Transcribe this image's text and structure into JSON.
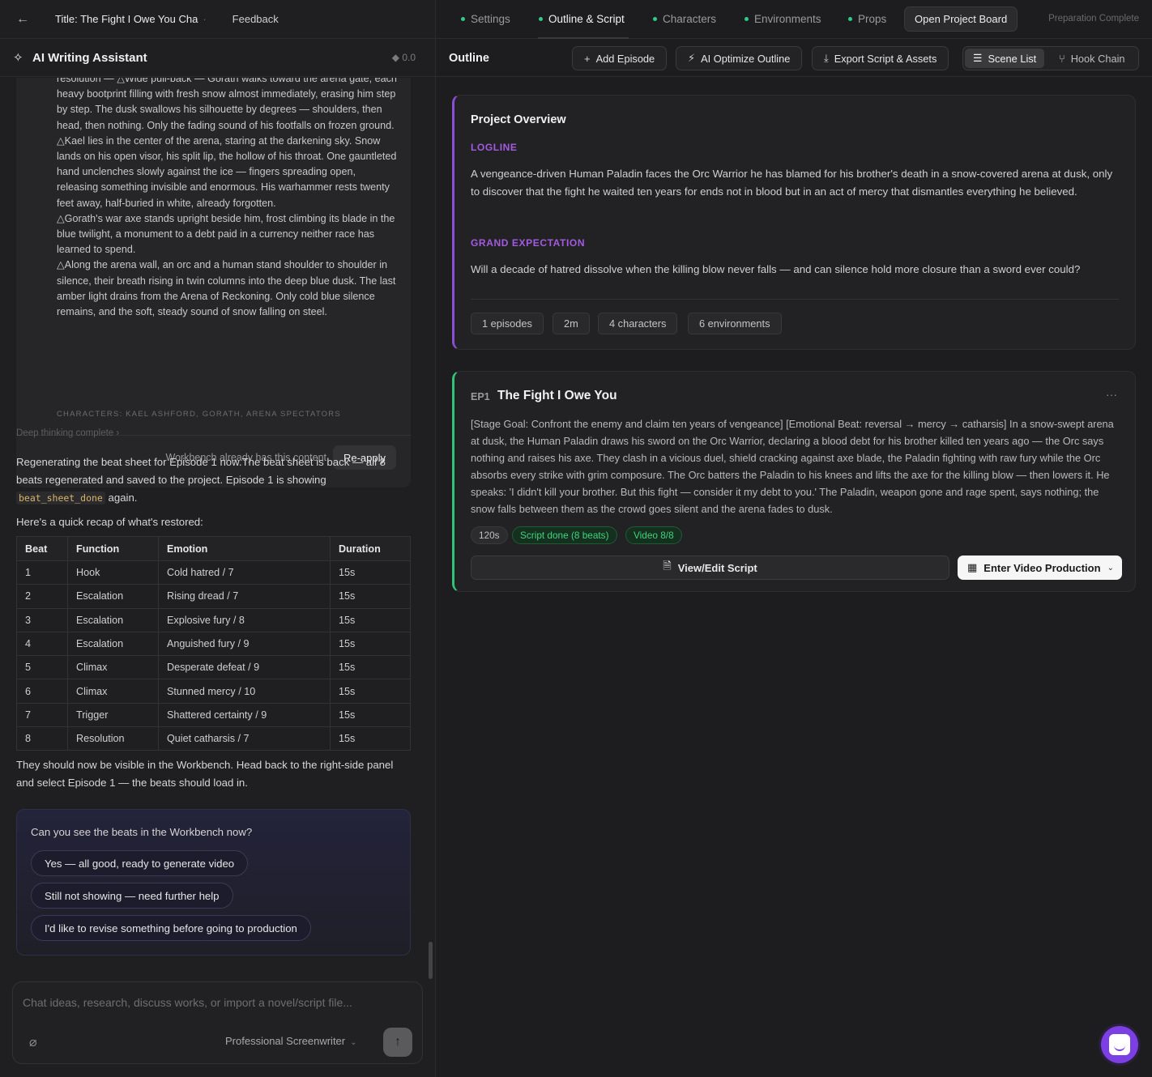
{
  "topbar": {
    "back_icon": "arrow-left-icon",
    "project_title": "Title: The Fight I Owe You Cha",
    "feedback": "Feedback"
  },
  "assistant": {
    "title": "AI Writing Assistant",
    "credits": "◆ 0.0"
  },
  "script_block": {
    "lines": [
      "resolution — △Wide pull-back — Gorath walks toward the arena gate, each heavy bootprint filling with fresh snow almost immediately, erasing him step by step. The dusk swallows his silhouette by degrees — shoulders, then head, then nothing. Only the fading sound of his footfalls on frozen ground.",
      "△Kael lies in the center of the arena, staring at the darkening sky. Snow lands on his open visor, his split lip, the hollow of his throat. One gauntleted hand unclenches slowly against the ice — fingers spreading open, releasing something invisible and enormous. His warhammer rests twenty feet away, half-buried in white, already forgotten.",
      "△Gorath's war axe stands upright beside him, frost climbing its blade in the blue twilight, a monument to a debt paid in a currency neither race has learned to spend.",
      "△Along the arena wall, an orc and a human stand shoulder to shoulder in silence, their breath rising in twin columns into the deep blue dusk. The last amber light drains from the Arena of Reckoning. Only cold blue silence remains, and the soft, steady sound of snow falling on steel."
    ],
    "characters": "CHARACTERS: KAEL ASHFORD, GORATH, ARENA SPECTATORS",
    "workbench_note": "Workbench already has this content",
    "reapply": "Re-apply"
  },
  "chat": {
    "deep_thinking": "Deep thinking complete",
    "msg1_a": "Regenerating the beat sheet for Episode 1 now.The beat sheet is back — all 8 beats regenerated and saved to the project. Episode 1 is showing ",
    "msg1_code": "beat_sheet_done",
    "msg1_b": " again.",
    "msg2": "Here's a quick recap of what's restored:",
    "table_headers": [
      "Beat",
      "Function",
      "Emotion",
      "Duration"
    ],
    "table_rows": [
      [
        "1",
        "Hook",
        "Cold hatred / 7",
        "15s"
      ],
      [
        "2",
        "Escalation",
        "Rising dread / 7",
        "15s"
      ],
      [
        "3",
        "Escalation",
        "Explosive fury / 8",
        "15s"
      ],
      [
        "4",
        "Escalation",
        "Anguished fury / 9",
        "15s"
      ],
      [
        "5",
        "Climax",
        "Desperate defeat / 9",
        "15s"
      ],
      [
        "6",
        "Climax",
        "Stunned mercy / 10",
        "15s"
      ],
      [
        "7",
        "Trigger",
        "Shattered certainty / 9",
        "15s"
      ],
      [
        "8",
        "Resolution",
        "Quiet catharsis / 7",
        "15s"
      ]
    ],
    "msg3": "They should now be visible in the Workbench. Head back to the right-side panel and select Episode 1 — the beats should load in.",
    "question": "Can you see the beats in the Workbench now?",
    "options": [
      "Yes — all good, ready to generate video",
      "Still not showing — need further help",
      "I'd like to revise something before going to production"
    ]
  },
  "composer": {
    "placeholder": "Chat ideas, research, discuss works, or import a novel/script file...",
    "attach_icon": "paperclip-icon",
    "persona": "Professional Screenwriter",
    "send_icon": "arrow-up-icon"
  },
  "tabs": {
    "items": [
      "Settings",
      "Outline & Script",
      "Characters",
      "Environments",
      "Props"
    ],
    "active": "Outline & Script",
    "board": "Open Project Board",
    "status": "Preparation Complete",
    "status_dot_color": "#2ecc8a"
  },
  "outline": {
    "title": "Outline",
    "add_episode": "Add Episode",
    "optimize": "AI Optimize Outline",
    "export": "Export Script & Assets",
    "scene_list": "Scene List",
    "hook_chain": "Hook Chain"
  },
  "overview": {
    "title": "Project Overview",
    "logline_label": "LOGLINE",
    "logline": "A vengeance-driven Human Paladin faces the Orc Warrior he has blamed for his brother's death in a snow-covered arena at dusk, only to discover that the fight he waited ten years for ends not in blood but in an act of mercy that dismantles everything he believed.",
    "expectation_label": "GRAND EXPECTATION",
    "expectation": "Will a decade of hatred dissolve when the killing blow never falls — and can silence hold more closure than a sword ever could?",
    "stats": [
      "1 episodes",
      "2m",
      "4 characters",
      "6 environments"
    ],
    "accent_color": "#8a4fd6"
  },
  "episode": {
    "number": "EP1",
    "title": "The Fight I Owe You",
    "more_icon": "ellipsis-icon",
    "synopsis": "[Stage Goal: Confront the enemy and claim ten years of vengeance] [Emotional Beat: reversal → mercy → catharsis] In a snow-swept arena at dusk, the Human Paladin draws his sword on the Orc Warrior, declaring a blood debt for his brother killed ten years ago — the Orc says nothing and raises his axe. They clash in a vicious duel, shield cracking against axe blade, the Paladin fighting with raw fury while the Orc absorbs every strike with grim composure. The Orc batters the Paladin to his knees and lifts the axe for the killing blow — then lowers it. He speaks: 'I didn't kill your brother. But this fight — consider it my debt to you.' The Paladin, weapon gone and rage spent, says nothing; the snow falls between them as the crowd goes silent and the arena fades to dusk.",
    "duration": "120s",
    "script_status": "Script done (8 beats)",
    "video_status": "Video 8/8",
    "view_edit": "View/Edit Script",
    "enter_video": "Enter Video Production",
    "accent_color": "#33c27a"
  },
  "help": {
    "icon": "chat-support-icon",
    "color": "#7b3fe4"
  }
}
